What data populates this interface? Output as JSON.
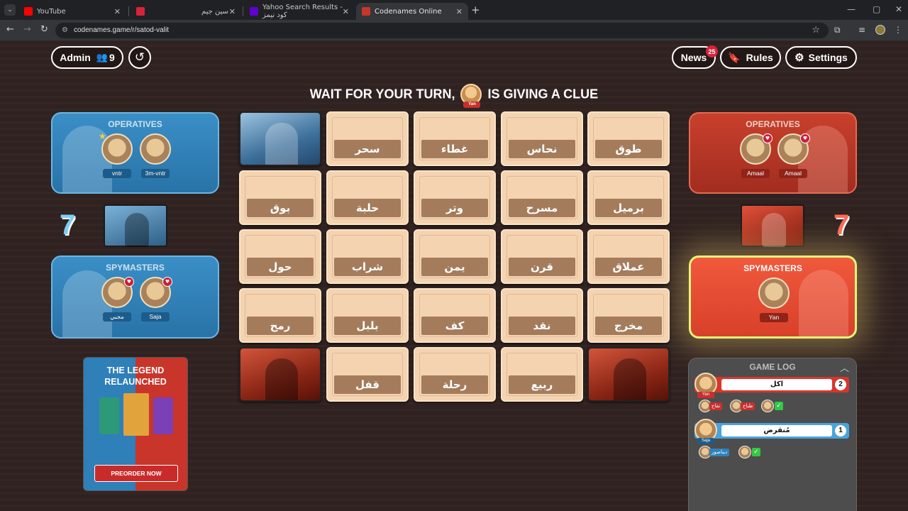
{
  "browser": {
    "tabs": [
      {
        "label": "YouTube",
        "favicon_color": "#ff0000"
      },
      {
        "label": "سين جيم",
        "favicon_color": "#d8243a"
      },
      {
        "label": "Yahoo Search Results - كود نيمز",
        "favicon_color": "#6001d2"
      },
      {
        "label": "Codenames Online",
        "favicon_color": "#c9352a",
        "active": true
      }
    ],
    "url": "codenames.game/r/satod-valit"
  },
  "header": {
    "admin_label": "Admin",
    "player_count": "9",
    "news_label": "News",
    "news_badge": "25",
    "rules_label": "Rules",
    "settings_label": "Settings"
  },
  "status": {
    "prefix": "WAIT FOR YOUR TURN,",
    "suffix": "IS GIVING A CLUE",
    "player": "Yan"
  },
  "blue_team": {
    "color": "#2f82bb",
    "score": "7",
    "operatives_title": "OPERATIVES",
    "operatives": [
      "vntr",
      "3m-vntr"
    ],
    "spymasters_title": "SPYMASTERS",
    "spymasters": [
      "مجبي",
      "Saja"
    ]
  },
  "red_team": {
    "color": "#d8402a",
    "score": "7",
    "operatives_title": "OPERATIVES",
    "operatives": [
      "Amaal",
      "Amaal"
    ],
    "spymasters_title": "SPYMASTERS",
    "spymasters": [
      "Yan"
    ]
  },
  "board": {
    "cards": [
      {
        "word": "",
        "state": "blue"
      },
      {
        "word": "سحر",
        "state": "hidden"
      },
      {
        "word": "غطاء",
        "state": "hidden"
      },
      {
        "word": "نحاس",
        "state": "hidden"
      },
      {
        "word": "طوق",
        "state": "hidden"
      },
      {
        "word": "بوق",
        "state": "hidden"
      },
      {
        "word": "حلبة",
        "state": "hidden"
      },
      {
        "word": "وتر",
        "state": "hidden"
      },
      {
        "word": "مسرح",
        "state": "hidden"
      },
      {
        "word": "برميل",
        "state": "hidden"
      },
      {
        "word": "حول",
        "state": "hidden"
      },
      {
        "word": "شراب",
        "state": "hidden"
      },
      {
        "word": "يمن",
        "state": "hidden"
      },
      {
        "word": "قرن",
        "state": "hidden"
      },
      {
        "word": "عملاق",
        "state": "hidden"
      },
      {
        "word": "رمح",
        "state": "hidden"
      },
      {
        "word": "بلبل",
        "state": "hidden"
      },
      {
        "word": "كف",
        "state": "hidden"
      },
      {
        "word": "نقد",
        "state": "hidden"
      },
      {
        "word": "مخرج",
        "state": "hidden"
      },
      {
        "word": "",
        "state": "red"
      },
      {
        "word": "قفل",
        "state": "hidden"
      },
      {
        "word": "رحلة",
        "state": "hidden"
      },
      {
        "word": "ربيع",
        "state": "hidden"
      },
      {
        "word": "",
        "state": "red"
      }
    ]
  },
  "promo": {
    "title_line1": "THE LEGEND",
    "title_line2": "RELAUNCHED",
    "button": "PREORDER NOW"
  },
  "game_log": {
    "title": "GAME LOG",
    "entries": [
      {
        "giver": "Yan",
        "team": "red",
        "clue": "اكل",
        "number": "2",
        "guesses": [
          {
            "player": "Amaal",
            "word": "نفاح"
          },
          {
            "player": "Amaal",
            "word": "طباخ"
          },
          {
            "player": "Amaal",
            "word": ""
          }
        ]
      },
      {
        "giver": "Saja",
        "team": "blue",
        "clue": "مُنقرض",
        "number": "1",
        "guesses": [
          {
            "player": "3m-vntr",
            "word": "ديناصور"
          },
          {
            "player": "vntr",
            "word": ""
          }
        ]
      }
    ]
  }
}
